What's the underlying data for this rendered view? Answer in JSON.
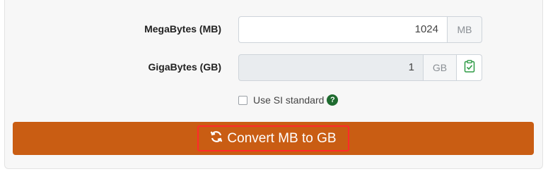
{
  "megabytes": {
    "label": "MegaBytes (MB)",
    "value": "1024",
    "unit": "MB"
  },
  "gigabytes": {
    "label": "GigaBytes (GB)",
    "value": "1",
    "unit": "GB"
  },
  "si_option": {
    "label": "Use SI standard",
    "checked": false,
    "help_icon": "question-circle-icon"
  },
  "convert": {
    "label": "Convert MB to GB",
    "icon": "refresh-icon"
  },
  "colors": {
    "accent": "#c95d13",
    "highlight_border": "#ff2a2a",
    "help_icon": "#1e6b2f",
    "copy_icon": "#2e9b45"
  }
}
